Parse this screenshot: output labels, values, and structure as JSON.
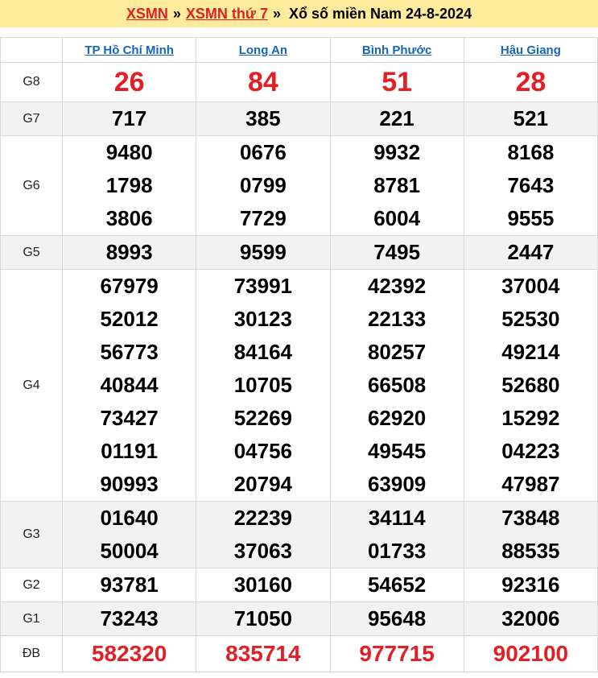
{
  "header": {
    "link1": "XSMN",
    "sep1": "»",
    "link2": "XSMN thứ 7",
    "sep2": "»",
    "title": "Xổ số miền Nam 24-8-2024"
  },
  "provinces": [
    "TP Hồ Chí Minh",
    "Long An",
    "Bình Phước",
    "Hậu Giang"
  ],
  "prizes": [
    {
      "label": "G8",
      "values": [
        [
          "26"
        ],
        [
          "84"
        ],
        [
          "51"
        ],
        [
          "28"
        ]
      ]
    },
    {
      "label": "G7",
      "values": [
        [
          "717"
        ],
        [
          "385"
        ],
        [
          "221"
        ],
        [
          "521"
        ]
      ]
    },
    {
      "label": "G6",
      "values": [
        [
          "9480",
          "1798",
          "3806"
        ],
        [
          "0676",
          "0799",
          "7729"
        ],
        [
          "9932",
          "8781",
          "6004"
        ],
        [
          "8168",
          "7643",
          "9555"
        ]
      ]
    },
    {
      "label": "G5",
      "values": [
        [
          "8993"
        ],
        [
          "9599"
        ],
        [
          "7495"
        ],
        [
          "2447"
        ]
      ]
    },
    {
      "label": "G4",
      "values": [
        [
          "67979",
          "52012",
          "56773",
          "40844",
          "73427",
          "01191",
          "90993"
        ],
        [
          "73991",
          "30123",
          "84164",
          "10705",
          "52269",
          "04756",
          "20794"
        ],
        [
          "42392",
          "22133",
          "80257",
          "66508",
          "62920",
          "49545",
          "63909"
        ],
        [
          "37004",
          "52530",
          "49214",
          "52680",
          "15292",
          "04223",
          "47987"
        ]
      ]
    },
    {
      "label": "G3",
      "values": [
        [
          "01640",
          "50004"
        ],
        [
          "22239",
          "37063"
        ],
        [
          "34114",
          "01733"
        ],
        [
          "73848",
          "88535"
        ]
      ]
    },
    {
      "label": "G2",
      "values": [
        [
          "93781"
        ],
        [
          "30160"
        ],
        [
          "54652"
        ],
        [
          "92316"
        ]
      ]
    },
    {
      "label": "G1",
      "values": [
        [
          "73243"
        ],
        [
          "71050"
        ],
        [
          "95648"
        ],
        [
          "32006"
        ]
      ]
    },
    {
      "label": "ĐB",
      "values": [
        [
          "582320"
        ],
        [
          "835714"
        ],
        [
          "977715"
        ],
        [
          "902100"
        ]
      ]
    }
  ]
}
